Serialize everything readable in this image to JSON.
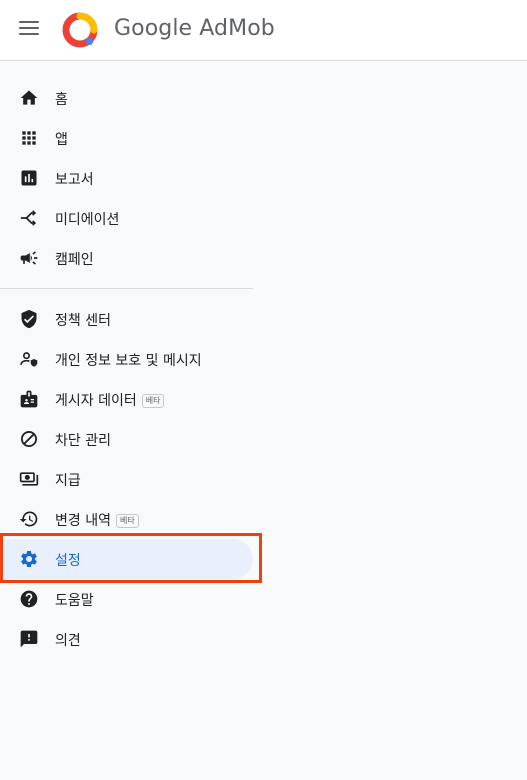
{
  "header": {
    "brand_google": "Google",
    "brand_product": " AdMob",
    "menu_icon": "hamburger-menu-icon"
  },
  "nav": {
    "primary": [
      {
        "label": "홈",
        "icon": "home-icon"
      },
      {
        "label": "앱",
        "icon": "apps-grid-icon"
      },
      {
        "label": "보고서",
        "icon": "report-chart-icon"
      },
      {
        "label": "미디에이션",
        "icon": "mediation-merge-icon"
      },
      {
        "label": "캠페인",
        "icon": "campaign-megaphone-icon"
      }
    ],
    "secondary": [
      {
        "label": "정책 센터",
        "icon": "shield-check-icon"
      },
      {
        "label": "개인 정보 보호 및 메시지",
        "icon": "privacy-person-icon"
      },
      {
        "label": "게시자 데이터",
        "badge": "베타",
        "icon": "badge-id-icon"
      },
      {
        "label": "차단 관리",
        "icon": "block-icon"
      },
      {
        "label": "지급",
        "icon": "payments-icon"
      },
      {
        "label": "변경 내역",
        "badge": "베타",
        "icon": "history-icon"
      },
      {
        "label": "설정",
        "icon": "settings-gear-icon",
        "active": true
      },
      {
        "label": "도움말",
        "icon": "help-icon"
      },
      {
        "label": "의견",
        "icon": "feedback-icon"
      }
    ]
  },
  "colors": {
    "active_bg": "#e8f0fe",
    "active_text": "#1967d2",
    "highlight_border": "#f0400d"
  }
}
